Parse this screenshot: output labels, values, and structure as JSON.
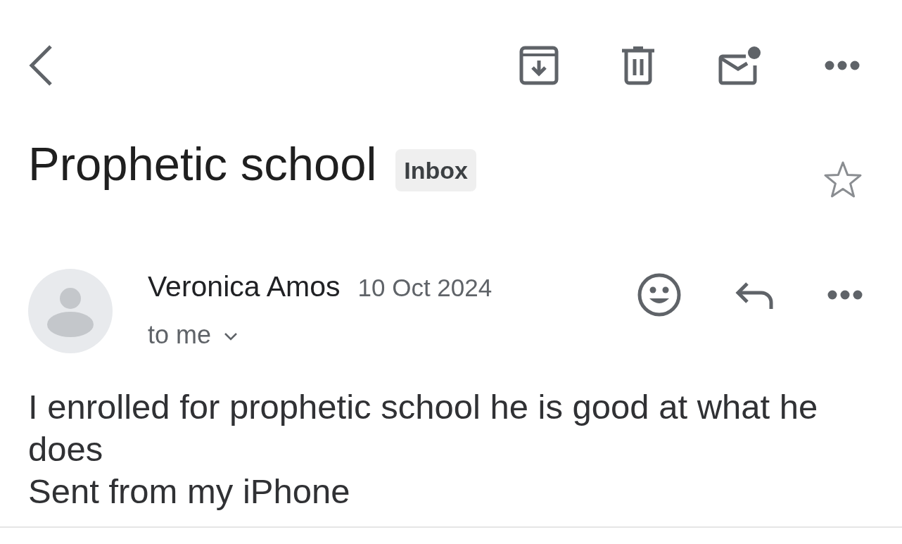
{
  "subject": {
    "title": "Prophetic school",
    "label": "Inbox",
    "starred": false
  },
  "message": {
    "sender": "Veronica Amos",
    "date": "10 Oct 2024",
    "recipient": "to me",
    "details_expanded": false,
    "body": [
      "I enrolled for prophetic school he is good at what he does",
      "Sent from my iPhone"
    ]
  }
}
